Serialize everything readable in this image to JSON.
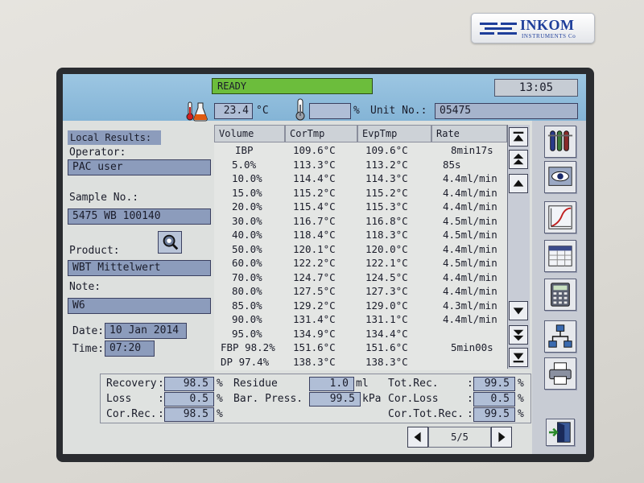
{
  "brand": {
    "name": "INKOM",
    "sub": "INSTRUMENTS Co"
  },
  "status": {
    "ready": "READY",
    "time": "13:05"
  },
  "ambient": {
    "temperature": "23.4",
    "temp_unit": "°C",
    "humidity": "",
    "humidity_unit": "%",
    "unit_label": "Unit No.:",
    "unit_no": "05475"
  },
  "left": {
    "header": "Local Results:",
    "operator_label": "Operator:",
    "operator": "PAC user",
    "sample_label": "Sample No.:",
    "sample": "5475 WB 100140",
    "product_label": "Product:",
    "product": "WBT Mittelwert",
    "note_label": "Note:",
    "note": "W6",
    "date_label": "Date:",
    "date": "10 Jan 2014",
    "time_label": "Time:",
    "time": "07:20"
  },
  "table": {
    "headers": [
      "Volume",
      "CorTmp",
      "EvpTmp",
      "Rate"
    ],
    "rows": [
      [
        "IBP",
        "109.6°C",
        "109.6°C",
        "8min17s"
      ],
      [
        "5.0%",
        "113.3°C",
        "113.2°C",
        "85s"
      ],
      [
        "10.0%",
        "114.4°C",
        "114.3°C",
        "4.4ml/min"
      ],
      [
        "15.0%",
        "115.2°C",
        "115.2°C",
        "4.4ml/min"
      ],
      [
        "20.0%",
        "115.4°C",
        "115.3°C",
        "4.4ml/min"
      ],
      [
        "30.0%",
        "116.7°C",
        "116.8°C",
        "4.5ml/min"
      ],
      [
        "40.0%",
        "118.4°C",
        "118.3°C",
        "4.5ml/min"
      ],
      [
        "50.0%",
        "120.1°C",
        "120.0°C",
        "4.4ml/min"
      ],
      [
        "60.0%",
        "122.2°C",
        "122.1°C",
        "4.5ml/min"
      ],
      [
        "70.0%",
        "124.7°C",
        "124.5°C",
        "4.4ml/min"
      ],
      [
        "80.0%",
        "127.5°C",
        "127.3°C",
        "4.4ml/min"
      ],
      [
        "85.0%",
        "129.2°C",
        "129.0°C",
        "4.3ml/min"
      ],
      [
        "90.0%",
        "131.4°C",
        "131.1°C",
        "4.4ml/min"
      ],
      [
        "95.0%",
        "134.9°C",
        "134.4°C",
        ""
      ],
      [
        "FBP 98.2%",
        "151.6°C",
        "151.6°C",
        "5min00s"
      ],
      [
        "DP 97.4%",
        "138.3°C",
        "138.3°C",
        ""
      ]
    ]
  },
  "summary": {
    "recovery_label": "Recovery",
    "recovery": "98.5",
    "recovery_unit": "%",
    "loss_label": "Loss",
    "loss": "0.5",
    "loss_unit": "%",
    "correc_label": "Cor.Rec.",
    "correc": "98.5",
    "correc_unit": "%",
    "residue_label": "Residue",
    "residue": "1.0",
    "residue_unit": "ml",
    "barpress_label": "Bar. Press.",
    "barpress": "99.5",
    "barpress_unit": "kPa",
    "totrec_label": "Tot.Rec.",
    "totrec": "99.5",
    "totrec_unit": "%",
    "corloss_label": "Cor.Loss",
    "corloss": "0.5",
    "corloss_unit": "%",
    "cortotrec_label": "Cor.Tot.Rec.",
    "cortotrec": "99.5",
    "cortotrec_unit": "%",
    "colon": ":"
  },
  "pager": {
    "label": "5/5"
  },
  "colors": {
    "ready": "#6cbd3c",
    "field": "#8c9cbc",
    "header_bar": "#9cc6e2"
  },
  "icons": [
    "flask-thermometer-icon",
    "thermometer-icon",
    "search-product-icon",
    "test-tubes-icon",
    "eye-display-icon",
    "graph-curve-icon",
    "data-table-icon",
    "calculator-icon",
    "network-icon",
    "printer-icon",
    "exit-door-icon"
  ]
}
